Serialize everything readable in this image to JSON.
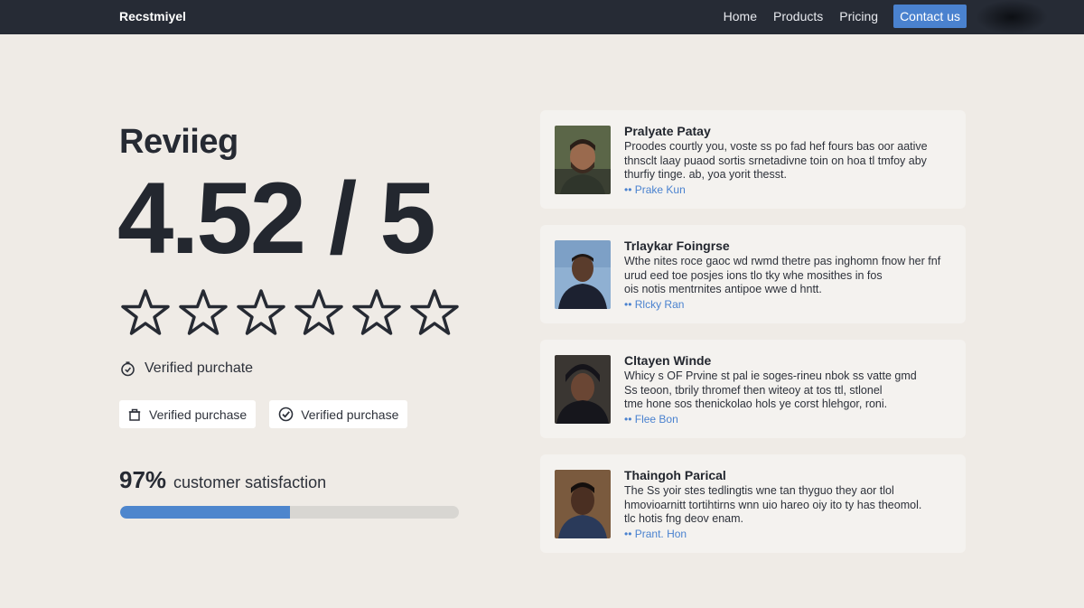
{
  "header": {
    "brand": "Recstmiyel",
    "nav": [
      "Home",
      "Products",
      "Pricing"
    ],
    "cta": "Contact us"
  },
  "rating": {
    "heading": "Reviieg",
    "value": "4.52 / 5",
    "stars_total": 5,
    "verified_text": "Verified purchate",
    "chips": [
      "Verified purchase",
      "Verified purchase"
    ],
    "satisfaction_pct": "97%",
    "satisfaction_label": "customer satisfaction",
    "satisfaction_fraction": 0.5
  },
  "reviews": [
    {
      "name": "Pralyate Patay",
      "text": [
        "Proodes courtly you, voste ss po fad hef fours bas oor aative",
        "thnsclt laay puaod sortis srnetadivne toin on hoa tl tmfoy aby",
        "thurfiy tinge. ab, yoa yorit thesst."
      ],
      "author": "•• Prake Kun"
    },
    {
      "name": "Trlaykar Foingrse",
      "text": [
        "Wthe nites roce gaoc wd rwmd thetre pas inghomn fnow her fnf",
        "urud eed toe posjes ions tlo tky whe mosithes in fos",
        "ois notis mentrnites antipoe wwe d hntt."
      ],
      "author": "•• Rlcky Ran"
    },
    {
      "name": "Cltayen Winde",
      "text": [
        "Whicy s OF Prvine st pal ie soges-rineu nbok ss vatte gmd",
        "Ss teoon, tbrily thromef then witeoy at tos ttl, stlonel",
        "tme hone sos thenickolao hols ye corst hlehgor, roni."
      ],
      "author": "•• Flee Bon"
    },
    {
      "name": "Thaingoh Parical",
      "text": [
        "The Ss yoir stes tedlingtis wne tan thyguo they aor tlol",
        "hmovioarnitt tortihtirns wnn uio hareo oiy ito ty has theomol.",
        "tlc hotis fng deov enam."
      ],
      "author": "•• Prant. Hon"
    }
  ],
  "colors": {
    "accent": "#4a82cf",
    "topbar": "#262b35",
    "page": "#efebe6",
    "card": "#f4f2ef"
  },
  "icons": [
    "clock-check-icon",
    "tag-icon",
    "check-circle-icon",
    "star-outline-icon"
  ]
}
